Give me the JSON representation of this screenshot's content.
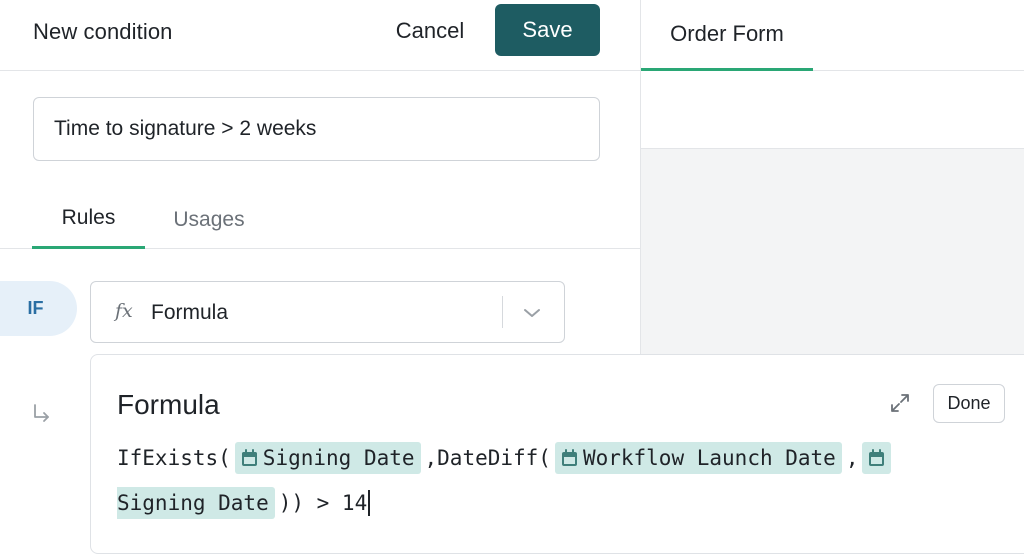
{
  "header": {
    "title": "New condition",
    "cancel_label": "Cancel",
    "save_label": "Save"
  },
  "condition": {
    "name": "Time to signature > 2 weeks"
  },
  "tabs": [
    {
      "label": "Rules",
      "active": true
    },
    {
      "label": "Usages",
      "active": false
    }
  ],
  "rule": {
    "if_label": "IF",
    "type_icon": "fx",
    "type_label": "Formula"
  },
  "formula_editor": {
    "title": "Formula",
    "done_label": "Done",
    "line1": {
      "prefix": "IfExists(",
      "token1": "Signing Date",
      "mid": ",DateDiff(",
      "token2": "Workflow Launch Date",
      "sep": ","
    },
    "line2": {
      "token3": "Signing Date",
      "suffix": ")) > 14"
    }
  },
  "preview": {
    "tab_label": "Order Form"
  },
  "colors": {
    "accent": "#2aa775",
    "save_button": "#1e5c62",
    "token_bg": "#cfe9e6",
    "if_badge_bg": "#e6f0f9",
    "if_badge_text": "#2a6ea3"
  },
  "icons": [
    "fx-icon",
    "chevron-down-icon",
    "sub-arrow-icon",
    "expand-icon",
    "calendar-icon"
  ]
}
